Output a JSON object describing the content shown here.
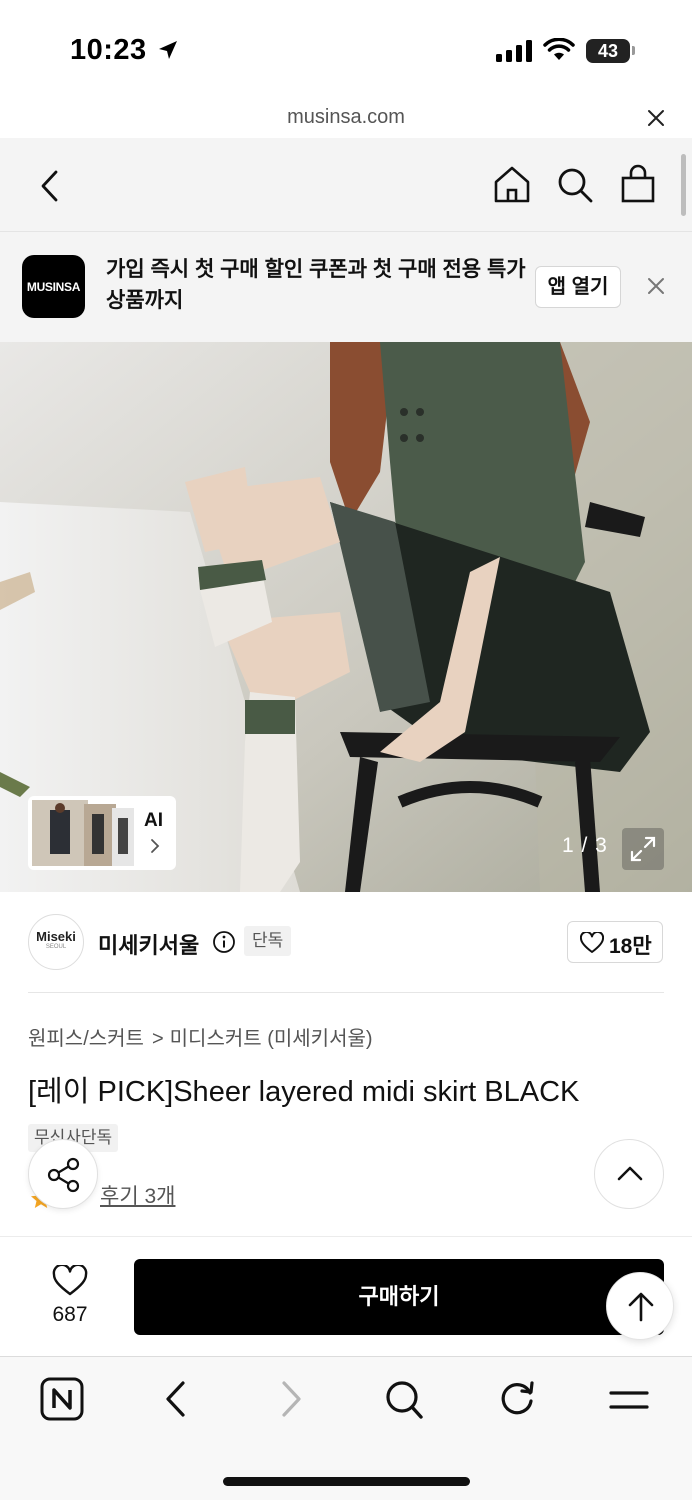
{
  "status_bar": {
    "time": "10:23",
    "battery": "43",
    "battery_level_percent": 43
  },
  "browser": {
    "url": "musinsa.com"
  },
  "app_banner": {
    "logo_text": "MUSINSA",
    "message": "가입 즉시 첫 구매 할인 쿠폰과 첫 구매 전용 특가 상품까지",
    "open_label": "앱 열기"
  },
  "gallery": {
    "ai_label": "AI",
    "page_indicator": "1 / 3"
  },
  "brand": {
    "logo_main": "Miseki",
    "logo_sub": "SEOUL",
    "name": "미세키서울",
    "exclusive_badge": "단독",
    "like_count": "18만"
  },
  "product": {
    "breadcrumb": [
      "원피스/스커트",
      "미디스커트 (미세키서울)"
    ],
    "breadcrumb_separator": ">",
    "title": "[레이 PICK]Sheer layered midi skirt BLACK",
    "exclusive_tag": "무신사단독",
    "rating": "5",
    "review_link": "후기 3개"
  },
  "purchase": {
    "wish_count": "687",
    "buy_label": "구매하기"
  },
  "colors": {
    "accent_star": "#f5a623",
    "buy_button": "#000000",
    "banner_bg": "#f4f4f4"
  }
}
